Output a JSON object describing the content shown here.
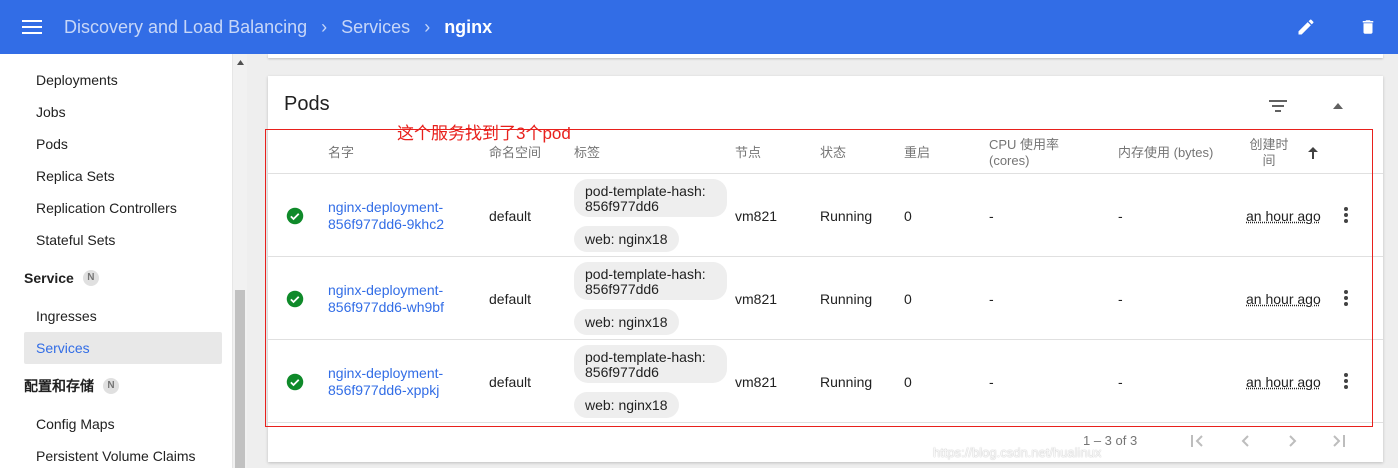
{
  "topbar": {
    "breadcrumbs": [
      "Discovery and Load Balancing",
      "Services"
    ],
    "current": "nginx",
    "menu_icon": "menu-icon",
    "actions": [
      "edit-icon",
      "delete-icon"
    ]
  },
  "sidebar": {
    "items": [
      {
        "label": "Deployments"
      },
      {
        "label": "Jobs"
      },
      {
        "label": "Pods"
      },
      {
        "label": "Replica Sets"
      },
      {
        "label": "Replication Controllers"
      },
      {
        "label": "Stateful Sets"
      }
    ],
    "service_section": {
      "label": "Service",
      "badge": "N"
    },
    "service_items": [
      {
        "label": "Ingresses"
      },
      {
        "label": "Services",
        "active": true
      }
    ],
    "config_section": {
      "label": "配置和存储",
      "badge": "N"
    },
    "config_items": [
      {
        "label": "Config Maps"
      },
      {
        "label": "Persistent Volume Claims"
      }
    ]
  },
  "card": {
    "title": "Pods",
    "annotation": "这个服务找到了3个pod",
    "columns": {
      "name": "名字",
      "namespace": "命名空间",
      "labels": "标签",
      "node": "节点",
      "status": "状态",
      "restarts": "重启",
      "cpu": "CPU 使用率 (cores)",
      "memory": "内存使用 (bytes)",
      "created": "创建时间"
    },
    "rows": [
      {
        "name_line1": "nginx-deployment-",
        "name_line2": "856f977dd6-9khc2",
        "namespace": "default",
        "label_hash": "pod-template-hash: 856f977dd6",
        "label_web": "web: nginx18",
        "node": "vm821",
        "status": "Running",
        "restarts": "0",
        "cpu": "-",
        "memory": "-",
        "age": "an hour ago"
      },
      {
        "name_line1": "nginx-deployment-",
        "name_line2": "856f977dd6-wh9bf",
        "namespace": "default",
        "label_hash": "pod-template-hash: 856f977dd6",
        "label_web": "web: nginx18",
        "node": "vm821",
        "status": "Running",
        "restarts": "0",
        "cpu": "-",
        "memory": "-",
        "age": "an hour ago"
      },
      {
        "name_line1": "nginx-deployment-",
        "name_line2": "856f977dd6-xppkj",
        "namespace": "default",
        "label_hash": "pod-template-hash: 856f977dd6",
        "label_web": "web: nginx18",
        "node": "vm821",
        "status": "Running",
        "restarts": "0",
        "cpu": "-",
        "memory": "-",
        "age": "an hour ago"
      }
    ],
    "pagination": "1 – 3 of 3"
  },
  "watermark": "https://blog.csdn.net/hualinux",
  "colors": {
    "brand": "#326de6",
    "success": "#0f8a2a",
    "annotation": "#e8201c"
  }
}
